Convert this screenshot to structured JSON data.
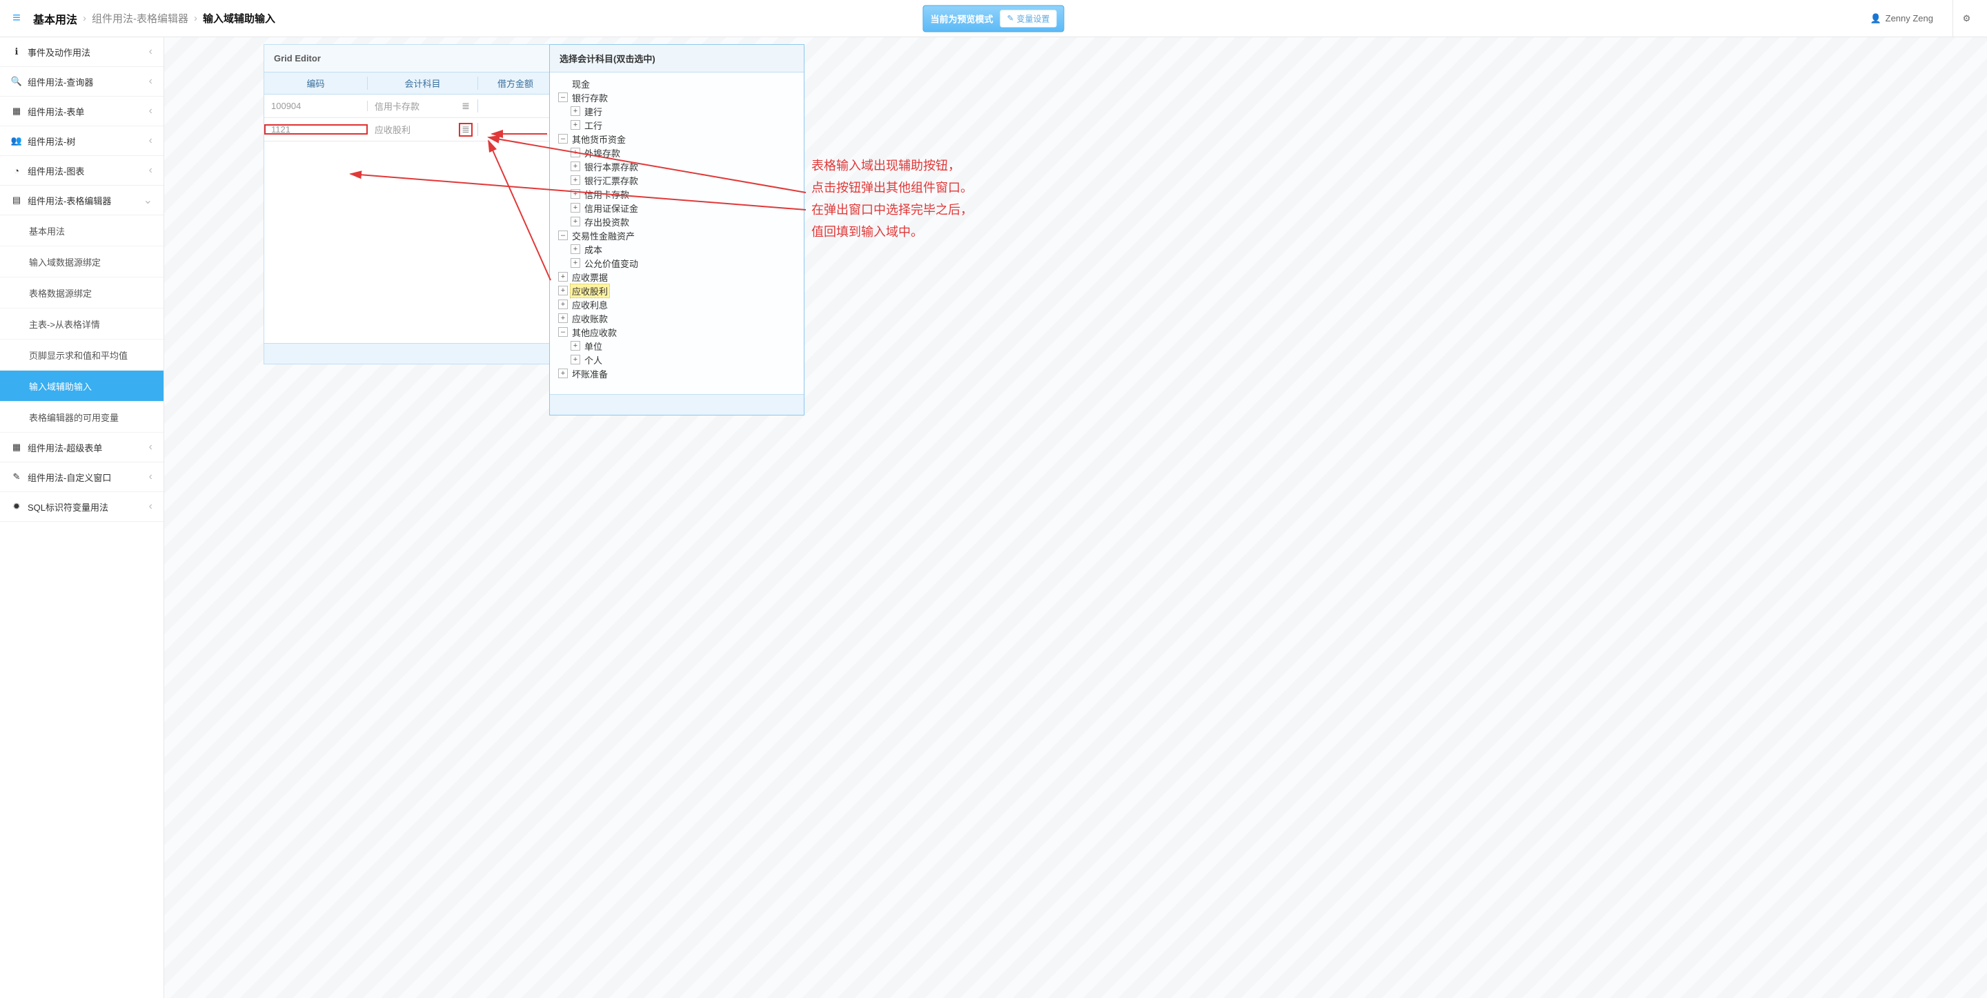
{
  "topbar": {
    "breadcrumb": [
      "基本用法",
      "组件用法-表格编辑器",
      "输入域辅助输入"
    ],
    "mode_label": "当前为预览模式",
    "var_btn_label": "变量设置",
    "user_name": "Zenny Zeng"
  },
  "sidebar": {
    "groups": [
      {
        "icon": "info-icon",
        "label": "事件及动作用法",
        "open": false
      },
      {
        "icon": "search-icon",
        "label": "组件用法-查询器",
        "open": false
      },
      {
        "icon": "form-icon",
        "label": "组件用法-表单",
        "open": false
      },
      {
        "icon": "tree-icon",
        "label": "组件用法-树",
        "open": false
      },
      {
        "icon": "chart-icon",
        "label": "组件用法-图表",
        "open": false
      },
      {
        "icon": "grid-icon",
        "label": "组件用法-表格编辑器",
        "open": true,
        "children": [
          "基本用法",
          "输入域数据源绑定",
          "表格数据源绑定",
          "主表->从表格详情",
          "页脚显示求和值和平均值",
          "输入域辅助输入",
          "表格编辑器的可用变量"
        ],
        "active_child_index": 5
      },
      {
        "icon": "form-icon",
        "label": "组件用法-超级表单",
        "open": false
      },
      {
        "icon": "edit-icon",
        "label": "组件用法-自定义窗口",
        "open": false
      },
      {
        "icon": "db-icon",
        "label": "SQL标识符变量用法",
        "open": false
      }
    ]
  },
  "grid_editor": {
    "title": "Grid Editor",
    "columns": [
      "编码",
      "会计科目",
      "借方金额"
    ],
    "rows": [
      {
        "code": "100904",
        "subject": "信用卡存款"
      },
      {
        "code": "1121",
        "subject": "应收股利"
      }
    ],
    "active_row_index": 1
  },
  "tree_popup": {
    "title": "选择会计科目(双击选中)",
    "selected_label": "应收股利",
    "nodes": [
      {
        "depth": 0,
        "expand": "leaf",
        "label": "现金"
      },
      {
        "depth": 0,
        "expand": "open",
        "label": "银行存款"
      },
      {
        "depth": 1,
        "expand": "close",
        "label": "建行"
      },
      {
        "depth": 1,
        "expand": "close",
        "label": "工行"
      },
      {
        "depth": 0,
        "expand": "open",
        "label": "其他货币资金"
      },
      {
        "depth": 1,
        "expand": "close",
        "label": "外埠存款"
      },
      {
        "depth": 1,
        "expand": "close",
        "label": "银行本票存款"
      },
      {
        "depth": 1,
        "expand": "close",
        "label": "银行汇票存款"
      },
      {
        "depth": 1,
        "expand": "close",
        "label": "信用卡存款"
      },
      {
        "depth": 1,
        "expand": "close",
        "label": "信用证保证金"
      },
      {
        "depth": 1,
        "expand": "close",
        "label": "存出投资款"
      },
      {
        "depth": 0,
        "expand": "open",
        "label": "交易性金融资产"
      },
      {
        "depth": 1,
        "expand": "close",
        "label": "成本"
      },
      {
        "depth": 1,
        "expand": "close",
        "label": "公允价值变动"
      },
      {
        "depth": 0,
        "expand": "close",
        "label": "应收票据"
      },
      {
        "depth": 0,
        "expand": "close",
        "label": "应收股利"
      },
      {
        "depth": 0,
        "expand": "close",
        "label": "应收利息"
      },
      {
        "depth": 0,
        "expand": "close",
        "label": "应收账款"
      },
      {
        "depth": 0,
        "expand": "open",
        "label": "其他应收款"
      },
      {
        "depth": 1,
        "expand": "close",
        "label": "单位"
      },
      {
        "depth": 1,
        "expand": "close",
        "label": "个人"
      },
      {
        "depth": 0,
        "expand": "close",
        "label": "坏账准备"
      }
    ]
  },
  "annotation": {
    "lines": [
      "表格输入域出现辅助按钮，",
      "点击按钮弹出其他组件窗口。",
      "在弹出窗口中选择完毕之后，",
      "值回填到输入域中。"
    ]
  },
  "icons": {
    "hamburger": "≡",
    "pencil": "✎",
    "user": "👤",
    "gears": "⚙",
    "chev_left": "‹",
    "chev_down": "⌄",
    "list": "≣",
    "info": "ℹ",
    "search": "🔍",
    "form": "▦",
    "tree": "👥",
    "chart": "◔",
    "grid": "▤",
    "edit": "✎",
    "db": "✹"
  }
}
